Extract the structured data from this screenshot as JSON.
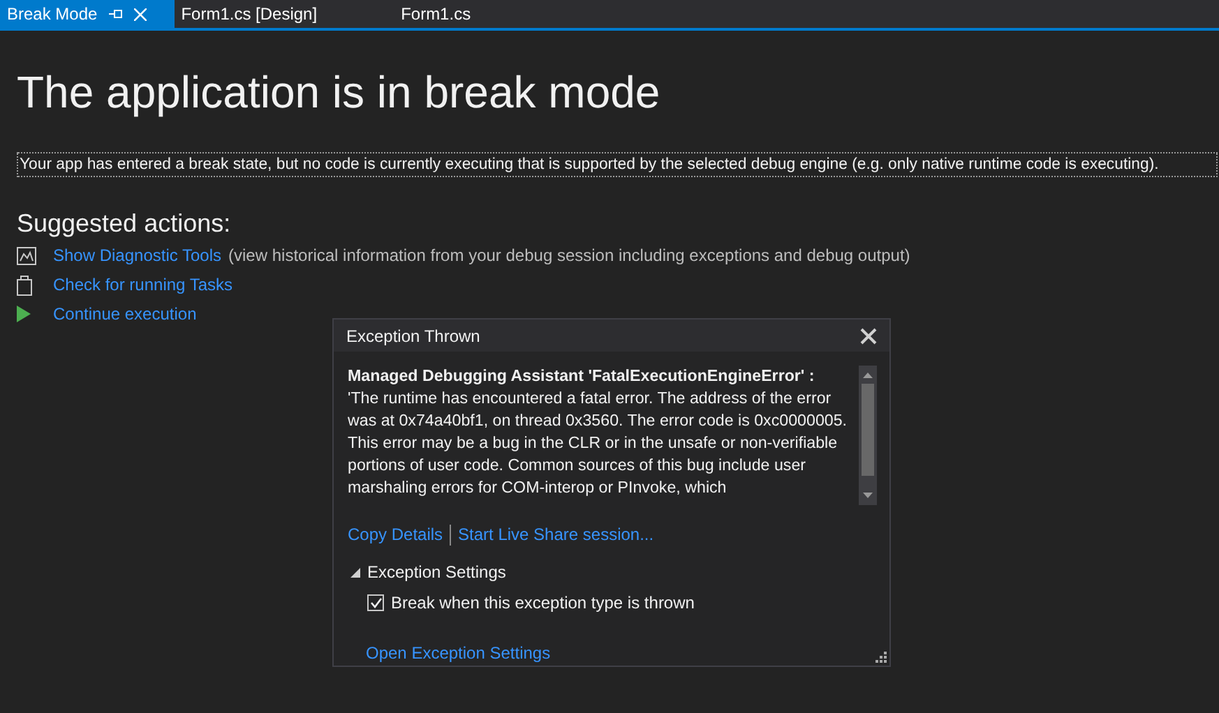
{
  "tabs": [
    {
      "label": "Break Mode",
      "selected": true,
      "pinned": true
    },
    {
      "label": "Form1.cs [Design]",
      "selected": false,
      "pinned": false
    },
    {
      "label": "Form1.cs",
      "selected": false,
      "pinned": false
    }
  ],
  "heading": "The application is in break mode",
  "message": "Your app has entered a break state, but no code is currently executing that is supported by the selected debug engine (e.g. only native runtime code is executing).",
  "suggested": {
    "title": "Suggested actions:",
    "actions": [
      {
        "kind": "diagnostic",
        "link": "Show Diagnostic Tools",
        "note": "(view historical information from your debug session including exceptions and debug output)"
      },
      {
        "kind": "tasks",
        "link": "Check for running Tasks"
      },
      {
        "kind": "continue",
        "link": "Continue execution"
      }
    ]
  },
  "dialog": {
    "title": "Exception Thrown",
    "heading": "Managed Debugging Assistant 'FatalExecutionEngineError' :",
    "body": "'The runtime has encountered a fatal error. The address of the error was at 0x74a40bf1, on thread 0x3560. The error code is 0xc0000005. This error may be a bug in the CLR or in the unsafe or non-verifiable portions of user code. Common sources of this bug include user marshaling errors for COM-interop or PInvoke, which",
    "links": [
      "Copy Details",
      "Start Live Share session..."
    ],
    "settings": {
      "title": "Exception Settings",
      "expanded": true,
      "checkbox": {
        "label": "Break when this exception type is thrown",
        "checked": true
      },
      "link": "Open Exception Settings"
    }
  }
}
